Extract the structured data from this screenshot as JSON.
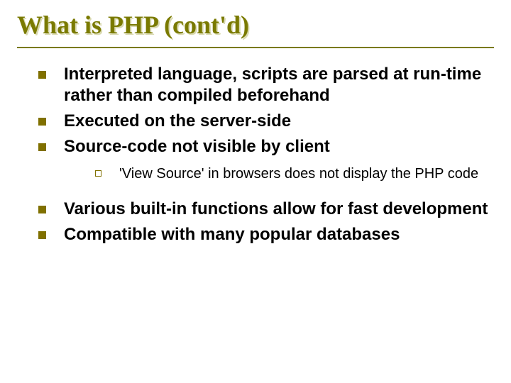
{
  "title": "What is PHP (cont'd)",
  "bullets_top": [
    "Interpreted language, scripts are parsed at run-time rather than compiled beforehand",
    "Executed on the server-side",
    "Source-code not visible by client"
  ],
  "sub_bullets": [
    "'View Source' in browsers does not display the PHP code"
  ],
  "bullets_bottom": [
    "Various built-in functions allow for fast development",
    "Compatible with many popular databases"
  ]
}
